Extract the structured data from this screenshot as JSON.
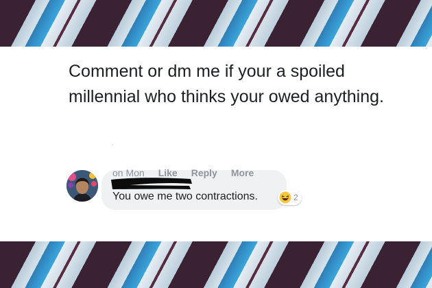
{
  "post": {
    "text": "Comment or dm me if your a spoiled millennial who thinks your owed anything."
  },
  "comment": {
    "text": "You owe me two contractions.",
    "reaction_icon": "laughing-emoji-icon",
    "reaction_count": "2",
    "timestamp": "on Mon",
    "like_label": "Like",
    "reply_label": "Reply",
    "more_label": "More"
  },
  "colors": {
    "bubble": "#eff1f3",
    "action_text": "#90949c",
    "band_dark": "#3a2233",
    "band_blue": "#2e7fb7"
  }
}
